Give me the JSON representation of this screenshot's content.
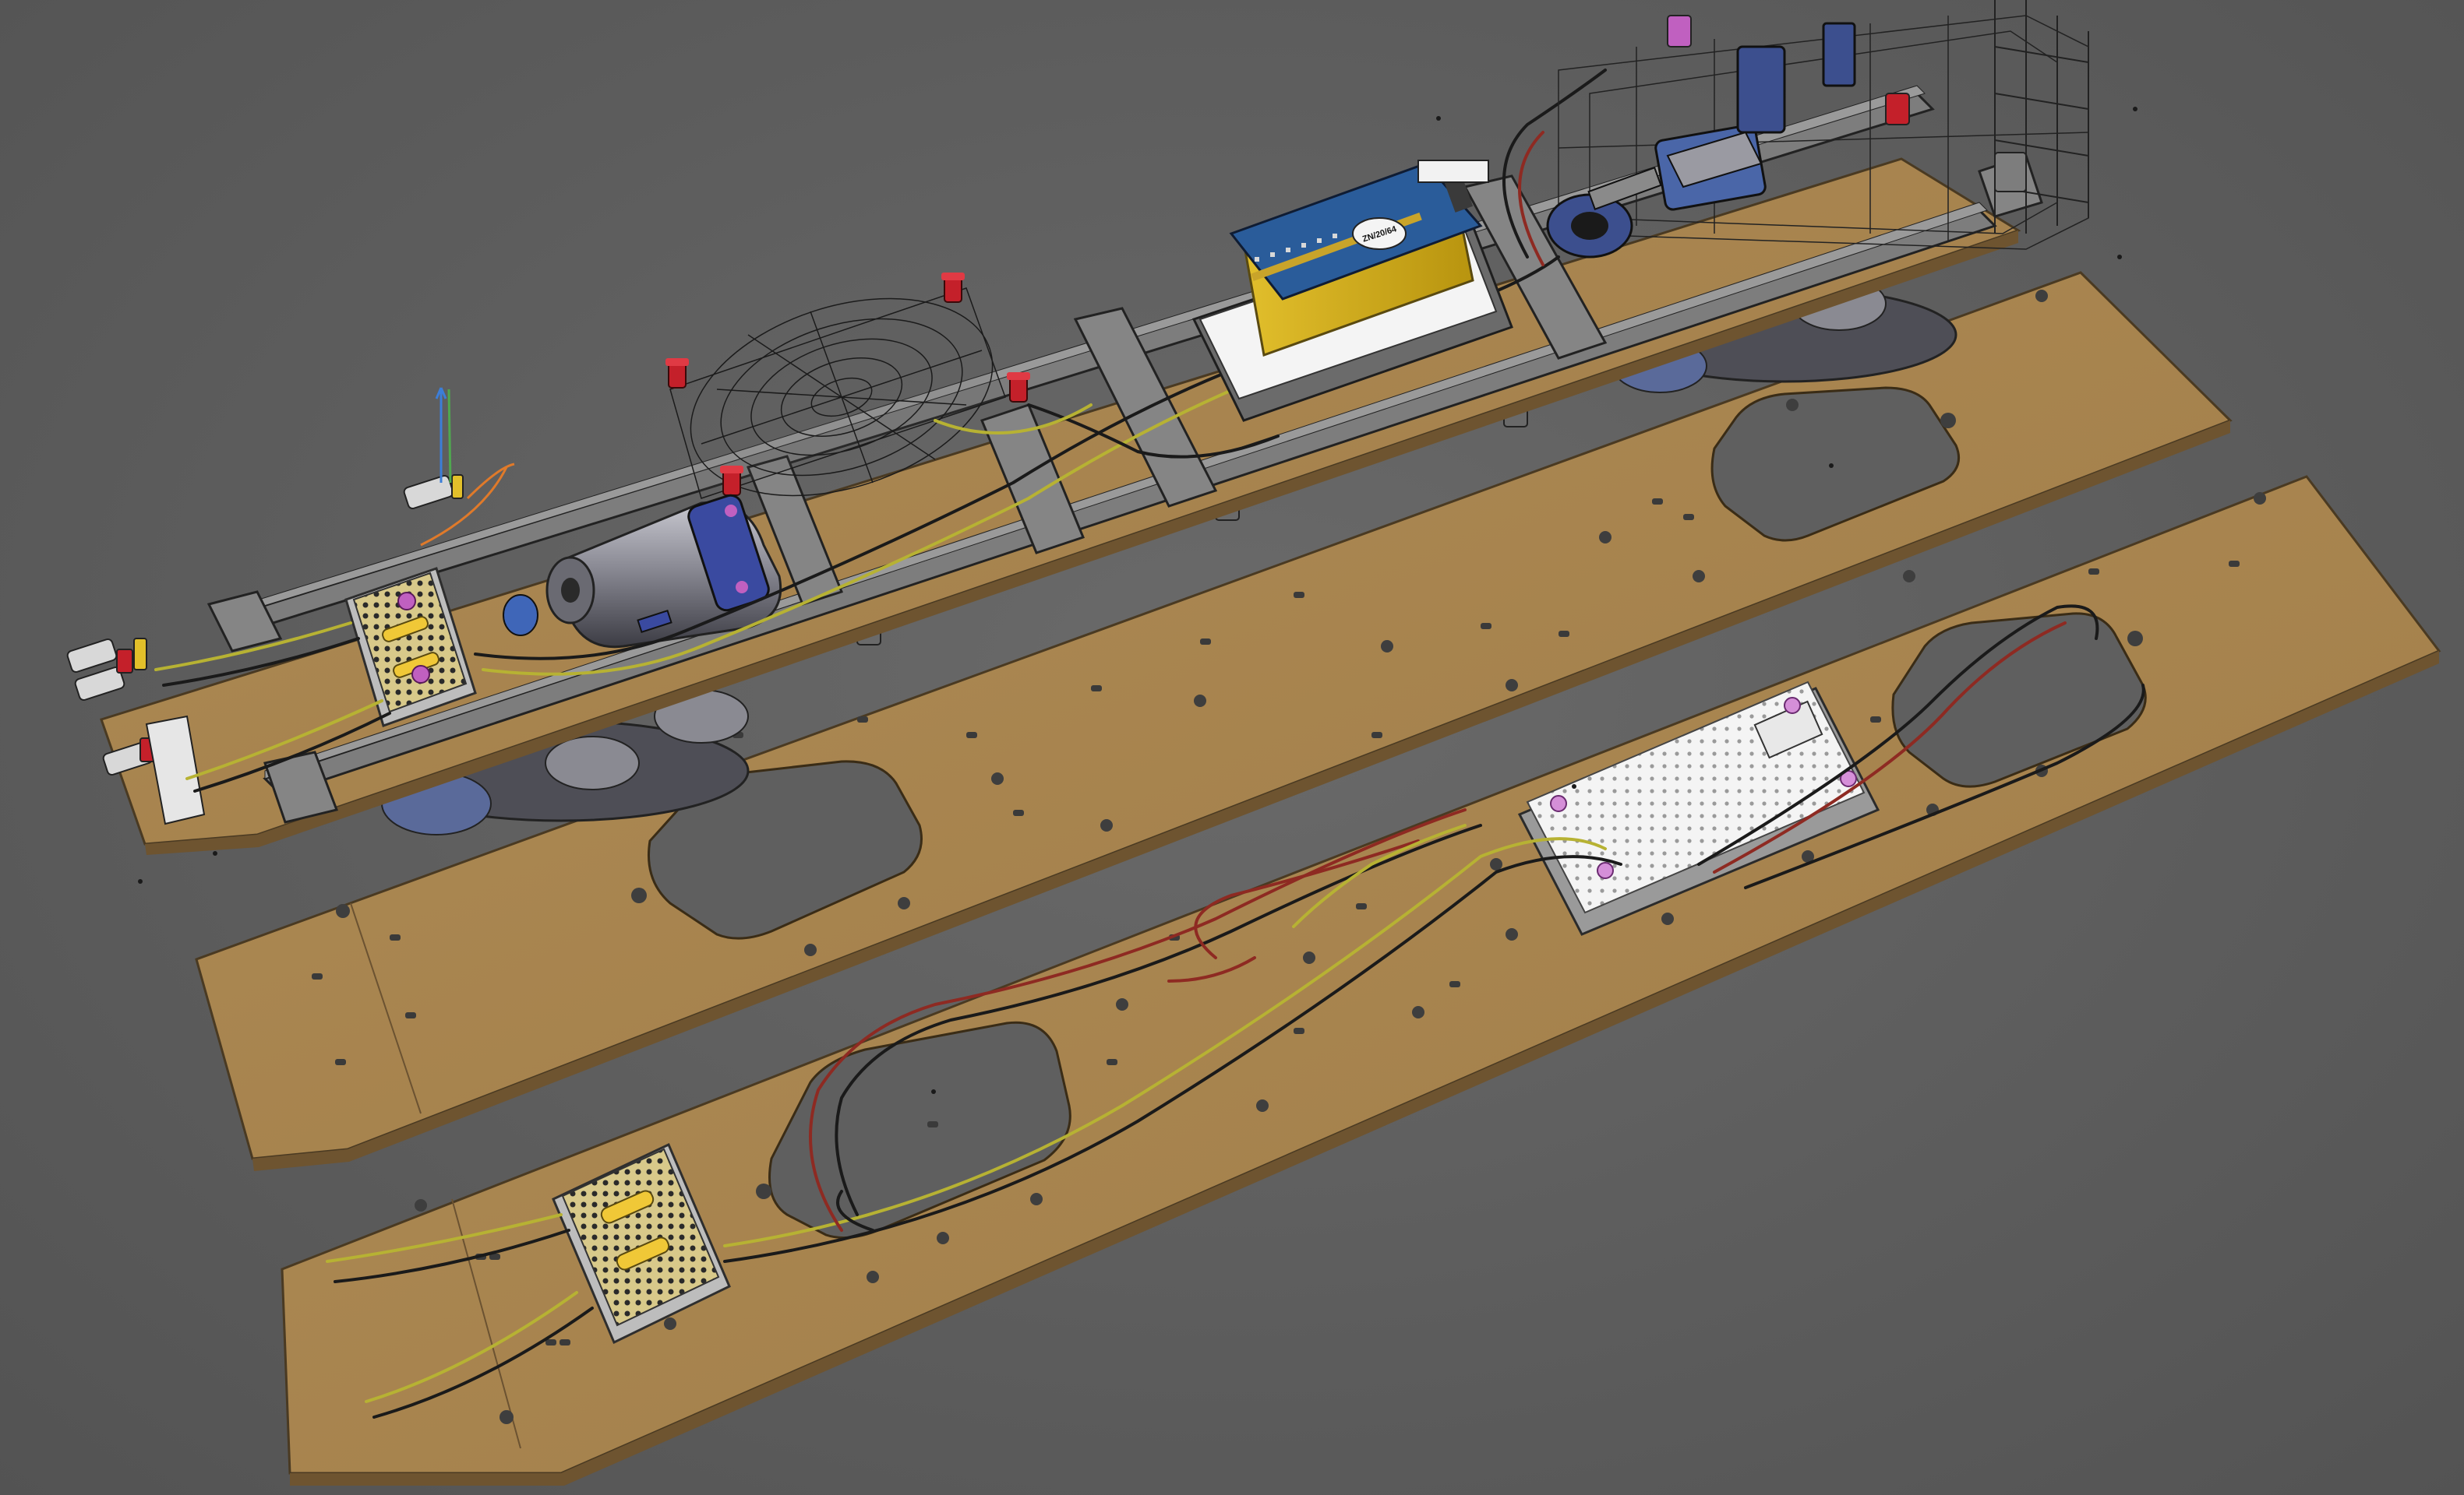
{
  "viewport": {
    "background": "#5e5e5e",
    "accent": "#b08a52"
  },
  "decoder": {
    "label": "ZN/20/64"
  },
  "colors": {
    "plate_fill": "#a9844e",
    "plate_edge": "#4a3a22",
    "frame_fill": "#7d7d7d",
    "frame_edge": "#2a2a2a",
    "pcb_blue": "#2a5c9a",
    "pcb_white": "#f2f2f2",
    "wire_red": "#8e2a22",
    "wire_yellow": "#b7b233",
    "wire_black": "#1a1a1a",
    "bolt_red": "#c4202a",
    "bolt_pink": "#c060c0",
    "motor_grey": "#9a9aa2"
  }
}
